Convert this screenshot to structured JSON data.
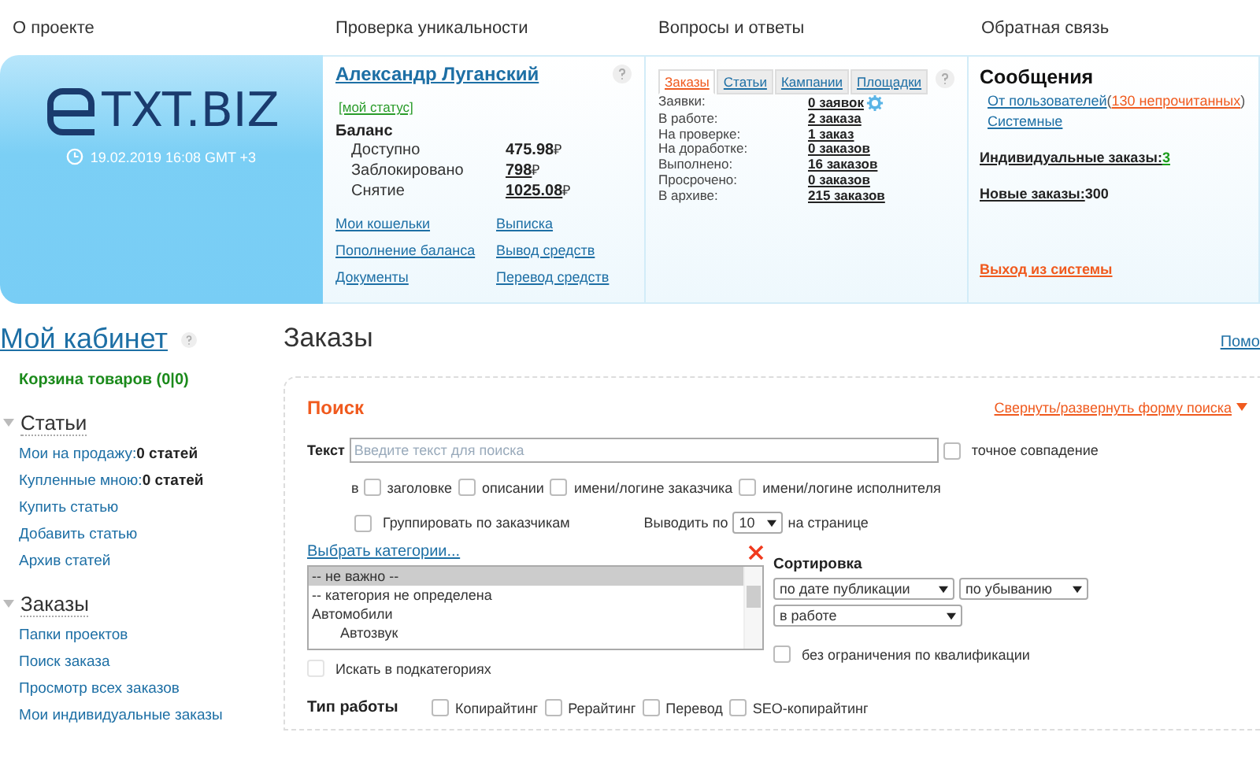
{
  "top_nav": [
    {
      "label": "О проекте"
    },
    {
      "label": "Проверка уникальности"
    },
    {
      "label": "Вопросы и ответы"
    },
    {
      "label": "Обратная связь"
    }
  ],
  "banner": {
    "logo": "TXT.BIZ",
    "datetime": "19.02.2019 16:08 GMT +3",
    "account": {
      "name": "Александр Луганский",
      "status": "[мой статус]",
      "balance_title": "Баланс",
      "balance": [
        {
          "label": "Доступно",
          "value": "475.98",
          "currency": "₽",
          "link": false
        },
        {
          "label": "Заблокировано",
          "value": "798",
          "currency": "₽",
          "link": true
        },
        {
          "label": "Снятие",
          "value": "1025.08",
          "currency": "₽",
          "link": true
        }
      ],
      "links": [
        "Мои кошельки",
        "Выписка",
        "Пополнение баланса",
        "Вывод средств",
        "Документы",
        "Перевод средств"
      ]
    },
    "orders": {
      "tabs": [
        {
          "label": "Заказы",
          "selected": true
        },
        {
          "label": "Статьи",
          "selected": false
        },
        {
          "label": "Кампании",
          "selected": false
        },
        {
          "label": "Площадки",
          "selected": false
        }
      ],
      "rows": [
        {
          "label": "Заявки:",
          "value": "0 заявок",
          "settings": true
        },
        {
          "label": "В работе:",
          "value": "2 заказа",
          "settings": false
        },
        {
          "label": "На проверке:",
          "value": "1 заказ",
          "settings": false
        },
        {
          "label": "На доработке:",
          "value": "0 заказов",
          "settings": false
        },
        {
          "label": "Выполнено:",
          "value": "16 заказов",
          "settings": false
        },
        {
          "label": "Просрочено:",
          "value": "0 заказов",
          "settings": false
        },
        {
          "label": "В архиве:",
          "value": "215 заказов",
          "settings": false
        }
      ]
    },
    "feedback": {
      "title": "Сообщения",
      "from_users": "От пользователей",
      "open_paren": "(",
      "unread": "130 непрочитанных",
      "close_paren": ")",
      "system": "Системные",
      "individual_label": "Индивидуальные заказы:",
      "individual_value": "3",
      "new_label": "Новые заказы:",
      "new_value": "300",
      "logout": "Выход из системы"
    }
  },
  "sidebar": {
    "title": "Мой кабинет",
    "cart": "Корзина товаров (0|0)",
    "sections": [
      {
        "title": "Статьи",
        "expanded": true,
        "items": [
          {
            "label": "Мои на продажу:",
            "value": "0 статей"
          },
          {
            "label": "Купленные мною:",
            "value": "0 статей"
          },
          {
            "label": "Купить статью"
          },
          {
            "label": "Добавить статью"
          },
          {
            "label": "Архив статей"
          }
        ]
      },
      {
        "title": "Заказы",
        "expanded": true,
        "items": [
          {
            "label": "Папки проектов"
          },
          {
            "label": "Поиск заказа"
          },
          {
            "label": "Просмотр всех заказов"
          },
          {
            "label": "Мои индивидуальные заказы"
          }
        ]
      }
    ]
  },
  "main": {
    "title": "Заказы",
    "help_link": "Помо",
    "search": {
      "title": "Поиск",
      "toggle": "Свернуть/развернуть форму поиска",
      "text_label": "Текст",
      "placeholder": "Введите текст для поиска",
      "exact": {
        "label": "точное совпадение",
        "checked": false
      },
      "in_label": "в",
      "in_fields": [
        {
          "label": "заголовке",
          "checked": false
        },
        {
          "label": "описании",
          "checked": false
        },
        {
          "label": "имени/логине заказчика",
          "checked": false
        },
        {
          "label": "имени/логине исполнителя",
          "checked": false
        }
      ],
      "group": {
        "label": "Группировать по заказчикам",
        "checked": false
      },
      "per_page_label": "Выводить по",
      "per_page": "10",
      "per_page_suffix": "на странице",
      "categories_link": "Выбрать категории...",
      "categories": [
        {
          "label": "-- не важно --",
          "selected": true
        },
        {
          "label": "-- категория не определена",
          "selected": false
        },
        {
          "label": "Автомобили",
          "selected": false,
          "children": [
            {
              "label": "Автозвук",
              "selected": false
            }
          ]
        }
      ],
      "subcategories": {
        "label": "Искать в подкатегориях",
        "checked": false,
        "disabled": true
      },
      "sort_title": "Сортировка",
      "sort_by": "по дате публикации",
      "sort_order": "по убыванию",
      "status": "в работе",
      "no_limit": {
        "label": "без ограничения по квалификации",
        "checked": false
      },
      "work_type_label": "Тип работы",
      "work_types": [
        {
          "label": "Копирайтинг",
          "checked": false
        },
        {
          "label": "Рерайтинг",
          "checked": false
        },
        {
          "label": "Перевод",
          "checked": false
        },
        {
          "label": "SEO-копирайтинг",
          "checked": false
        }
      ]
    }
  }
}
